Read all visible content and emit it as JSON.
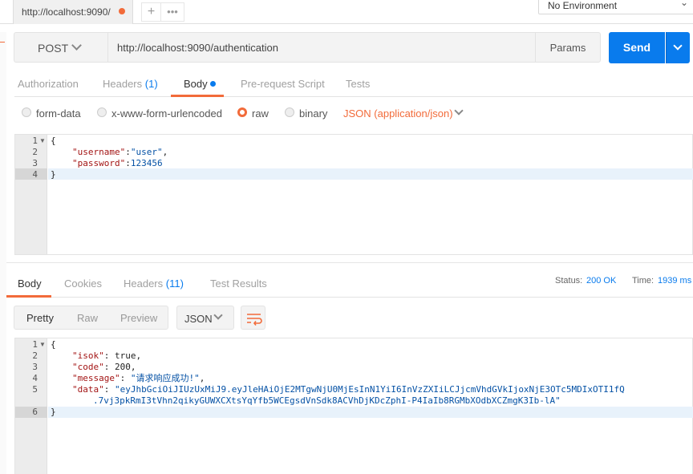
{
  "tabs": {
    "active_tab_url": "http://localhost:9090/",
    "new_tab": "+",
    "more": "•••"
  },
  "environment": {
    "selected": "No Environment"
  },
  "request": {
    "method": "POST",
    "url": "http://localhost:9090/authentication",
    "params_label": "Params",
    "send_label": "Send"
  },
  "request_tabs": {
    "authorization": "Authorization",
    "headers": "Headers",
    "headers_count": "(1)",
    "body": "Body",
    "prerequest": "Pre-request Script",
    "tests": "Tests"
  },
  "body_mode": {
    "form_data": "form-data",
    "urlencoded": "x-www-form-urlencoded",
    "raw": "raw",
    "binary": "binary",
    "content_type": "JSON (application/json)",
    "selected": "raw"
  },
  "request_body": {
    "line_numbers": [
      "1",
      "2",
      "3",
      "4"
    ],
    "l1": "{",
    "l2_key": "\"username\"",
    "l2_sep": ":",
    "l2_val": "\"user\"",
    "l2_end": ",",
    "l3_key": "\"password\"",
    "l3_sep": ":",
    "l3_val": "123456",
    "l4": "}"
  },
  "response_tabs": {
    "body": "Body",
    "cookies": "Cookies",
    "headers": "Headers",
    "headers_count": "(11)",
    "test_results": "Test Results"
  },
  "response_meta": {
    "status_label": "Status:",
    "status_value": "200 OK",
    "time_label": "Time:",
    "time_value": "1939 ms"
  },
  "view_modes": {
    "pretty": "Pretty",
    "raw": "Raw",
    "preview": "Preview",
    "format": "JSON"
  },
  "response_body": {
    "line_numbers": [
      "1",
      "2",
      "3",
      "4",
      "5",
      "6"
    ],
    "l1": "{",
    "isok_key": "\"isok\"",
    "isok_val": "true",
    "code_key": "\"code\"",
    "code_val": "200",
    "message_key": "\"message\"",
    "message_val": "\"请求响应成功!\"",
    "data_key": "\"data\"",
    "data_val_1": "\"eyJhbGciOiJIUzUxMiJ9.eyJleHAiOjE2MTgwNjU0MjEsInN1YiI6InVzZXIiLCJjcmVhdGVkIjoxNjE3OTc5MDIxOTI1fQ",
    "data_val_2": ".7vj3pkRmI3tVhn2qikyGUWXCXtsYqYfb5WCEgsdVnSdk8ACVhDjKDcZphI-P4IaIb8RGMbXOdbXCZmgK3Ib-lA\"",
    "l6": "}"
  },
  "colors": {
    "accent": "#f26b3a",
    "primary": "#097bed"
  }
}
